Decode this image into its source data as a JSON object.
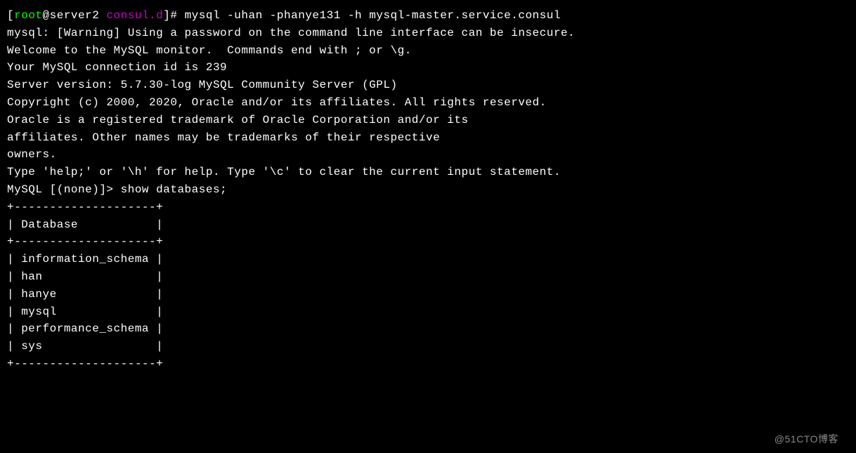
{
  "prompt": {
    "open_bracket": "[",
    "user": "root",
    "at": "@",
    "host": "server2 ",
    "dir": "consul.d",
    "close": "]# "
  },
  "command": "mysql -uhan -phanye131 -h mysql-master.service.consul",
  "output": {
    "line1": "mysql: [Warning] Using a password on the command line interface can be insecure.",
    "line2": "Welcome to the MySQL monitor.  Commands end with ; or \\g.",
    "line3": "Your MySQL connection id is 239",
    "line4": "Server version: 5.7.30-log MySQL Community Server (GPL)",
    "line5": "",
    "line6": "Copyright (c) 2000, 2020, Oracle and/or its affiliates. All rights reserved.",
    "line7": "",
    "line8": "Oracle is a registered trademark of Oracle Corporation and/or its",
    "line9": "affiliates. Other names may be trademarks of their respective",
    "line10": "owners.",
    "line11": "",
    "line12": "Type 'help;' or '\\h' for help. Type '\\c' to clear the current input statement.",
    "line13": ""
  },
  "mysql_prompt": "MySQL [(none)]> ",
  "mysql_command": "show databases;",
  "table": {
    "border_top": "+--------------------+",
    "header": "| Database           |",
    "border_mid": "+--------------------+",
    "row1": "| information_schema |",
    "row2": "| han                |",
    "row3": "| hanye              |",
    "row4": "| mysql              |",
    "row5": "| performance_schema |",
    "row6": "| sys                |",
    "border_bot": "+--------------------+"
  },
  "watermark": "@51CTO博客"
}
